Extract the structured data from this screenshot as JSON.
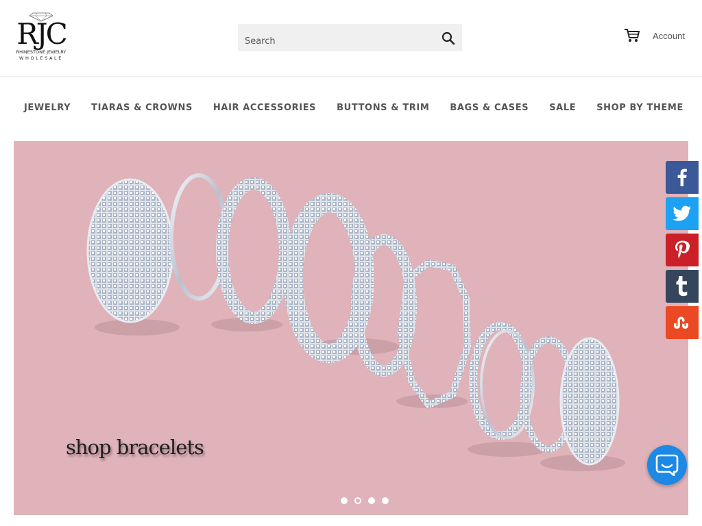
{
  "logo": {
    "mark": "RJC",
    "line1": "RHINESTONE JEWELRY",
    "line2": "WHOLESALE"
  },
  "search": {
    "placeholder": "Search",
    "button_icon": "search-icon"
  },
  "header": {
    "cart_icon": "cart-icon",
    "account_label": "Account"
  },
  "nav": {
    "items": [
      {
        "label": "JEWELRY"
      },
      {
        "label": "TIARAS & CROWNS"
      },
      {
        "label": "HAIR ACCESSORIES"
      },
      {
        "label": "BUTTONS & TRIM"
      },
      {
        "label": "BAGS & CASES"
      },
      {
        "label": "SALE"
      },
      {
        "label": "SHOP BY THEME"
      }
    ]
  },
  "hero": {
    "caption": "shop bracelets",
    "background_color": "#dfb3b9",
    "slide_count": 4,
    "active_slide": 2
  },
  "social": [
    {
      "name": "facebook",
      "icon": "facebook-icon",
      "color": "#3b5998"
    },
    {
      "name": "twitter",
      "icon": "twitter-icon",
      "color": "#1da1f2"
    },
    {
      "name": "pinterest",
      "icon": "pinterest-icon",
      "color": "#cb2027"
    },
    {
      "name": "tumblr",
      "icon": "tumblr-icon",
      "color": "#35465c"
    },
    {
      "name": "stumbleupon",
      "icon": "stumbleupon-icon",
      "color": "#eb4924"
    }
  ],
  "chat": {
    "icon": "chat-icon",
    "color": "#1e88e5"
  }
}
